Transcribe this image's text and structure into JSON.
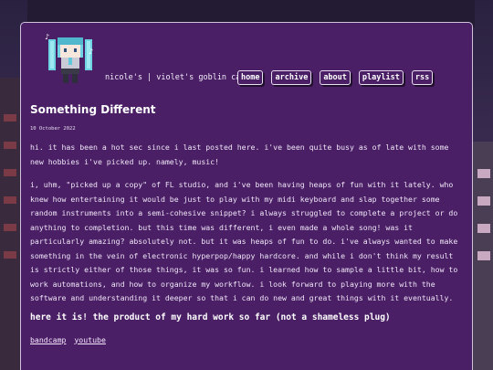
{
  "site": {
    "title": "nicole's | violet's goblin cave"
  },
  "nav": {
    "items": [
      "home",
      "archive",
      "about",
      "playlist",
      "rss"
    ]
  },
  "post": {
    "title": "Something Different",
    "date": "10 October 2022",
    "paragraphs": [
      "hi. it has been a hot sec since i last posted here. i've been quite busy as of late with some new hobbies i've picked up. namely, music!",
      "i, uhm, \"picked up a copy\" of FL studio, and i've been having heaps of fun with it lately. who knew how entertaining it would be just to play with my midi keyboard and slap together some random instruments into a semi-cohesive snippet? i always struggled to complete a project or do anything to completion. but this time was different, i even made a whole song! was it particularly amazing? absolutely not. but it was heaps of fun to do. i've always wanted to make something in the vein of electronic hyperpop/happy hardcore. and while i don't think my result is strictly either of those things, it was so fun. i learned how to sample a little bit, how to work automations, and how to organize my workflow. i look forward to playing more with the software and understanding it deeper so that i can do new and great things with it eventually."
    ],
    "subheading": "here it is! the product of my hard work so far (not a shameless plug)",
    "links": [
      "bandcamp",
      "youtube"
    ]
  },
  "colors": {
    "panel": "#4a1f66",
    "border": "#cfc3dc",
    "text": "#f1e9f7"
  },
  "icons": {
    "mascot": "pixel-miku-mascot-icon"
  }
}
